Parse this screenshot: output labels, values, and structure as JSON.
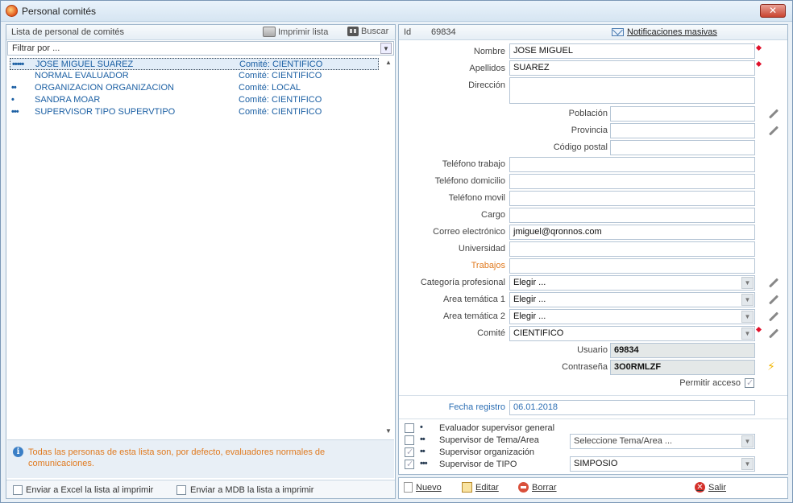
{
  "window": {
    "title": "Personal comités",
    "close_glyph": "✕"
  },
  "left": {
    "header": "Lista de personal de comités",
    "print_label": "Imprimir lista",
    "search_label": "Buscar",
    "filter_value": "Filtrar por ...",
    "rows": [
      {
        "dots": "•••••",
        "name": "JOSE MIGUEL SUAREZ",
        "comite": "Comité: CIENTIFICO"
      },
      {
        "dots": "",
        "name": "NORMAL EVALUADOR",
        "comite": "Comité: CIENTIFICO"
      },
      {
        "dots": "••",
        "name": "ORGANIZACION ORGANIZACION",
        "comite": "Comité: LOCAL"
      },
      {
        "dots": "•",
        "name": "SANDRA MOAR",
        "comite": "Comité: CIENTIFICO"
      },
      {
        "dots": "•••",
        "name": "SUPERVISOR TIPO SUPERVTIPO",
        "comite": "Comité: CIENTIFICO"
      }
    ],
    "info_text": "Todas las personas de esta lista son, por defecto, evaluadores normales de comunicaciones.",
    "excel_label": "Enviar a Excel la lista al imprimir",
    "mdb_label": "Enviar a MDB la lista a imprimir"
  },
  "right": {
    "id_label": "Id",
    "id_value": "69834",
    "notif_label": "Notificaciones masivas",
    "fields": {
      "nombre": {
        "label": "Nombre",
        "value": "JOSE MIGUEL"
      },
      "apellidos": {
        "label": "Apellidos",
        "value": "SUAREZ"
      },
      "direccion": {
        "label": "Dirección",
        "value": ""
      },
      "poblacion": {
        "label": "Población",
        "value": ""
      },
      "provincia": {
        "label": "Provincia",
        "value": ""
      },
      "cp": {
        "label": "Código postal",
        "value": ""
      },
      "tel_trabajo": {
        "label": "Teléfono trabajo",
        "value": ""
      },
      "tel_domicilio": {
        "label": "Teléfono domicilio",
        "value": ""
      },
      "tel_movil": {
        "label": "Teléfono movil",
        "value": ""
      },
      "cargo": {
        "label": "Cargo",
        "value": ""
      },
      "correo": {
        "label": "Correo electrónico",
        "value": "jmiguel@qronnos.com"
      },
      "universidad": {
        "label": "Universidad",
        "value": ""
      },
      "trabajos": {
        "label": "Trabajos",
        "value": ""
      },
      "categoria": {
        "label": "Categoría profesional",
        "value": "Elegir ..."
      },
      "area1": {
        "label": "Area temática 1",
        "value": "Elegir ..."
      },
      "area2": {
        "label": "Area temática 2",
        "value": "Elegir ..."
      },
      "comite": {
        "label": "Comité",
        "value": "CIENTIFICO"
      },
      "usuario": {
        "label": "Usuario",
        "value": "69834"
      },
      "contrasena": {
        "label": "Contraseña",
        "value": "3O0RMLZF"
      },
      "fecha": {
        "label": "Fecha registro",
        "value": "06.01.2018"
      }
    },
    "permitir_acceso": "Permitir acceso",
    "options": [
      {
        "dots": "•",
        "label": "Evaluador supervisor general"
      },
      {
        "dots": "••",
        "label": "Supervisor de Tema/Area"
      },
      {
        "dots": "••",
        "label": "Supervisor organización"
      },
      {
        "dots": "•••",
        "label": "Supervisor de TIPO"
      }
    ],
    "tema_select": "Seleccione Tema/Area ...",
    "tipo_select": "SIMPOSIO"
  },
  "actions": {
    "new": "Nuevo",
    "edit": "Editar",
    "delete": "Borrar",
    "exit": "Salir"
  }
}
